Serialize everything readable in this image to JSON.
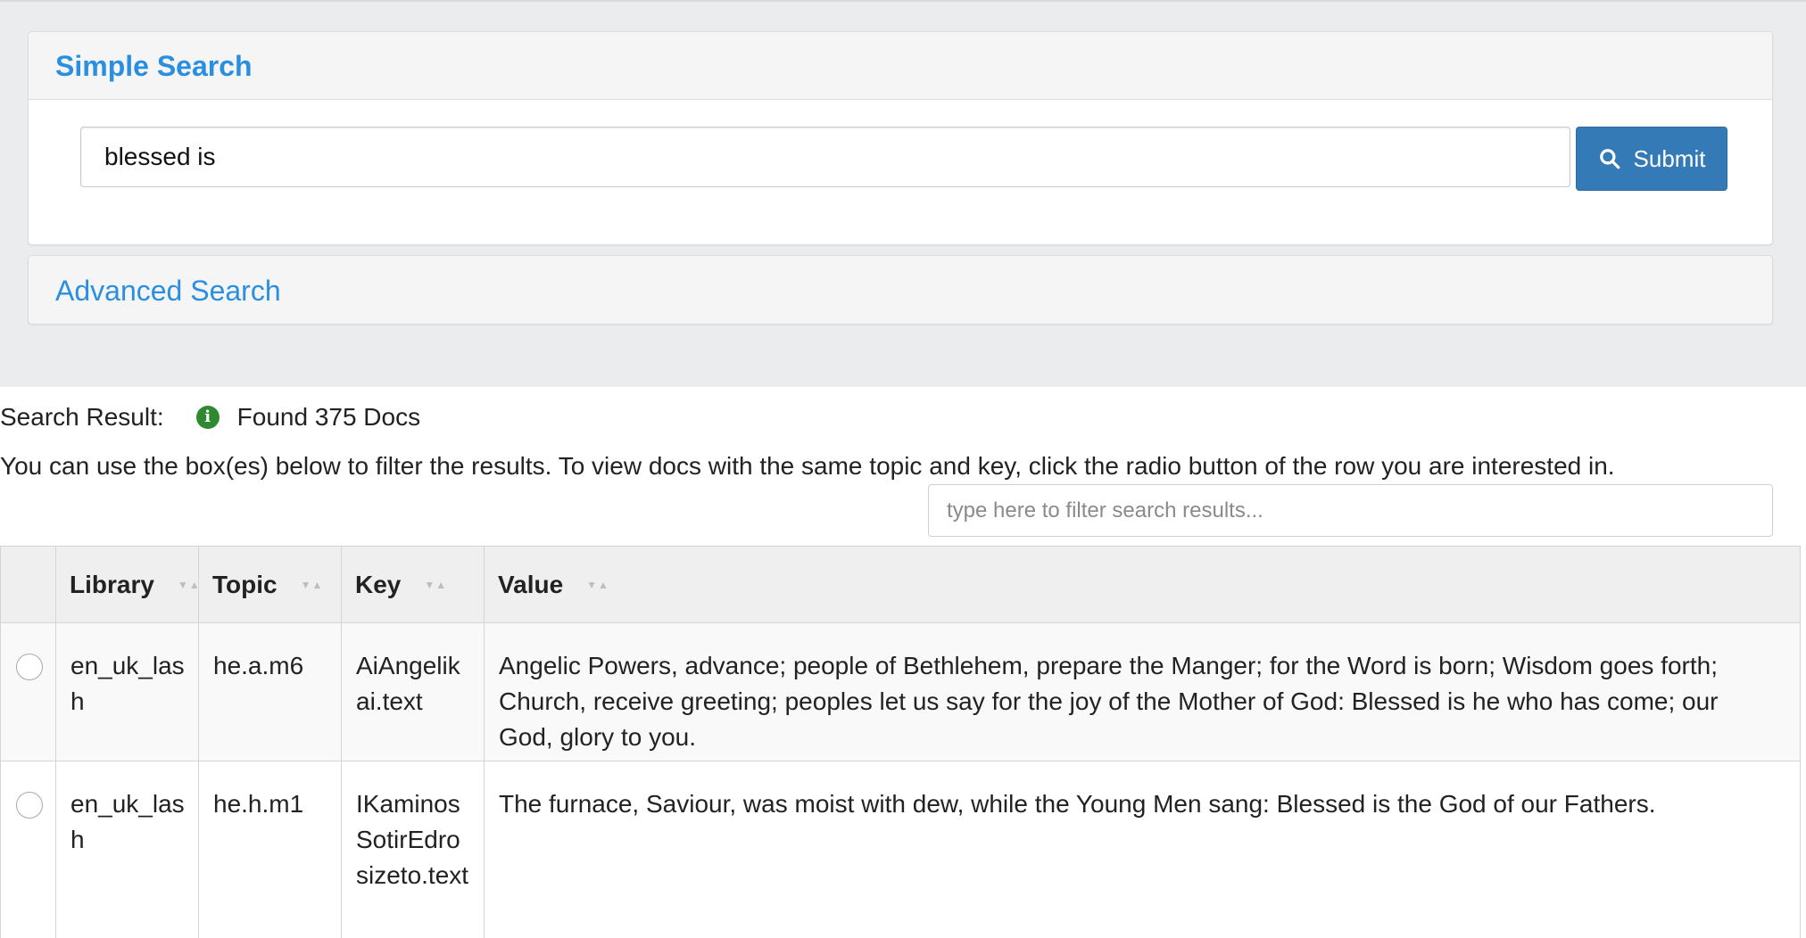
{
  "simple_search": {
    "title": "Simple Search",
    "query_value": "blessed is",
    "submit_label": "Submit"
  },
  "advanced_search": {
    "label": "Advanced Search"
  },
  "results": {
    "label": "Search Result:",
    "count_text": "Found 375 Docs",
    "help_text": "You can use the box(es) below to filter the results. To view docs with the same topic and key, click the radio button of the row you are interested in.",
    "filter_placeholder": "type here to filter search results..."
  },
  "table": {
    "columns": [
      "Library",
      "Topic",
      "Key",
      "Value"
    ],
    "rows": [
      {
        "library": "en_uk_lash",
        "topic": "he.a.m6",
        "key": "AiAngelikai.text",
        "value": "Angelic Powers, advance; people of Bethlehem, prepare the Manger; for the Word is born; Wisdom goes forth; Church, receive greeting; peoples let us say for the joy of the Mother of God: Blessed is he who has come; our God, glory to you."
      },
      {
        "library": "en_uk_lash",
        "topic": "he.h.m1",
        "key": "IKaminosSotirEdrosizeto.text",
        "value": "The furnace, Saviour, was moist with dew, while the Young Men sang: Blessed is the God of our Fathers."
      }
    ]
  },
  "colors": {
    "accent": "#2a8fe0",
    "button": "#337ab7",
    "info_icon": "#2f8a2f",
    "page_bg": "#ebecee"
  }
}
